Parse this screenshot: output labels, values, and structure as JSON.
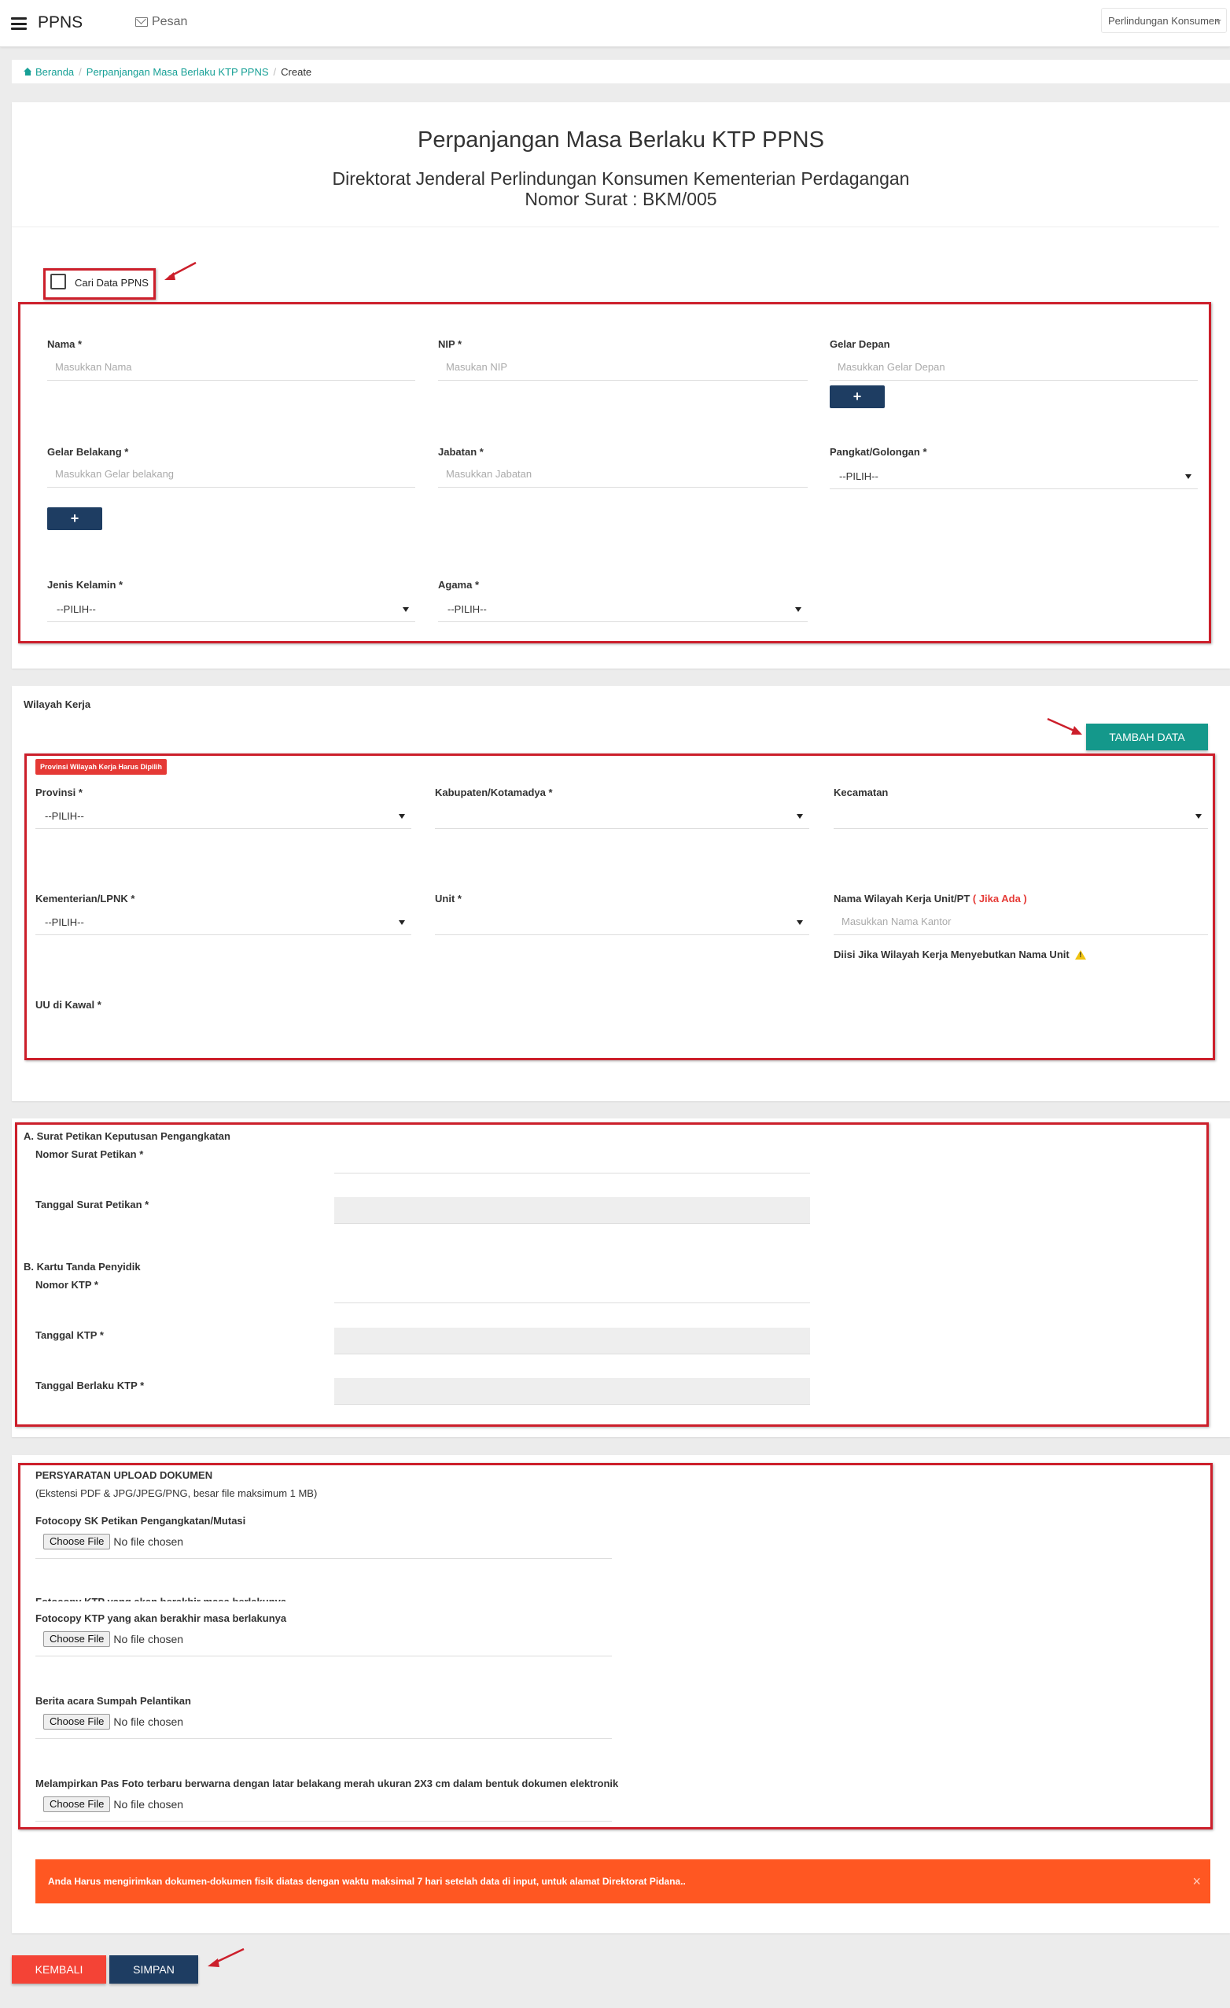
{
  "header": {
    "brand": "PPNS",
    "messages": "Pesan",
    "user_menu": "Perlindungan Konsumen"
  },
  "breadcrumb": {
    "home": "Beranda",
    "parent": "Perpanjangan Masa Berlaku KTP PPNS",
    "current": "Create"
  },
  "page": {
    "title": "Perpanjangan Masa Berlaku KTP PPNS",
    "subtitle": "Direktorat Jenderal Perlindungan Konsumen Kementerian Perdagangan",
    "letter_number": "Nomor Surat : BKM/005"
  },
  "search": {
    "checkbox_label": "Cari Data PPNS"
  },
  "identity": {
    "nama_label": "Nama *",
    "nama_placeholder": "Masukkan Nama",
    "nip_label": "NIP *",
    "nip_placeholder": "Masukan NIP",
    "gelar_depan_label": "Gelar Depan",
    "gelar_depan_placeholder": "Masukkan Gelar Depan",
    "gelar_belakang_label": "Gelar Belakang *",
    "gelar_belakang_placeholder": "Masukkan Gelar belakang",
    "jabatan_label": "Jabatan *",
    "jabatan_placeholder": "Masukkan Jabatan",
    "pangkat_label": "Pangkat/Golongan *",
    "pangkat_value": "--PILIH--",
    "jenis_kelamin_label": "Jenis Kelamin *",
    "jenis_kelamin_value": "--PILIH--",
    "agama_label": "Agama *",
    "agama_value": "--PILIH--",
    "plus": "+"
  },
  "wilayah": {
    "section_title": "Wilayah Kerja",
    "add_button": "TAMBAH DATA",
    "required_badge": "Provinsi Wilayah Kerja Harus Dipilih",
    "provinsi_label": "Provinsi *",
    "provinsi_value": "--PILIH--",
    "kabupaten_label": "Kabupaten/Kotamadya *",
    "kabupaten_value": "",
    "kecamatan_label": "Kecamatan",
    "kecamatan_value": "",
    "kementerian_label": "Kementerian/LPNK *",
    "kementerian_value": "--PILIH--",
    "unit_label": "Unit *",
    "unit_value": "",
    "nama_wilayah_label": "Nama Wilayah Kerja Unit/PT",
    "nama_wilayah_note": "( Jika Ada )",
    "nama_wilayah_placeholder": "Masukkan Nama Kantor",
    "nama_wilayah_hint": "Diisi Jika Wilayah Kerja Menyebutkan Nama Unit",
    "uu_label": "UU di Kawal *"
  },
  "surat": {
    "section_a": "A. Surat Petikan Keputusan Pengangkatan",
    "nomor_surat_label": "Nomor Surat Petikan *",
    "tanggal_surat_label": "Tanggal Surat Petikan *",
    "section_b": "B. Kartu Tanda Penyidik",
    "nomor_ktp_label": "Nomor KTP *",
    "tanggal_ktp_label": "Tanggal KTP *",
    "tanggal_berlaku_label": "Tanggal Berlaku KTP *"
  },
  "upload": {
    "title": "PERSYARATAN UPLOAD DOKUMEN",
    "subtitle": "(Ekstensi PDF & JPG/JPEG/PNG, besar file maksimum 1 MB)",
    "choose": "Choose File",
    "no_file": "No file chosen",
    "items": [
      "Fotocopy SK Petikan Pengangkatan/Mutasi",
      "Fotocopy KTP yang akan berakhir masa berlakunya",
      "Berita acara Sumpah Pelantikan",
      "Melampirkan Pas Foto terbaru berwarna dengan latar belakang merah ukuran 2X3 cm dalam bentuk dokumen elektronik"
    ],
    "ghost_item": "Fotocopy KTP yang akan berakhir masa berlakunya"
  },
  "alert": {
    "message": "Anda Harus mengirimkan dokumen-dokumen fisik diatas dengan waktu maksimal 7 hari setelah data di input, untuk alamat Direktorat Pidana..",
    "close": "×"
  },
  "actions": {
    "back": "KEMBALI",
    "save": "SIMPAN"
  },
  "colors": {
    "teal": "#14988b",
    "navy": "#1e3d62",
    "red": "#f44336",
    "orange": "#ff5722",
    "annotation": "#cc1f2b"
  }
}
